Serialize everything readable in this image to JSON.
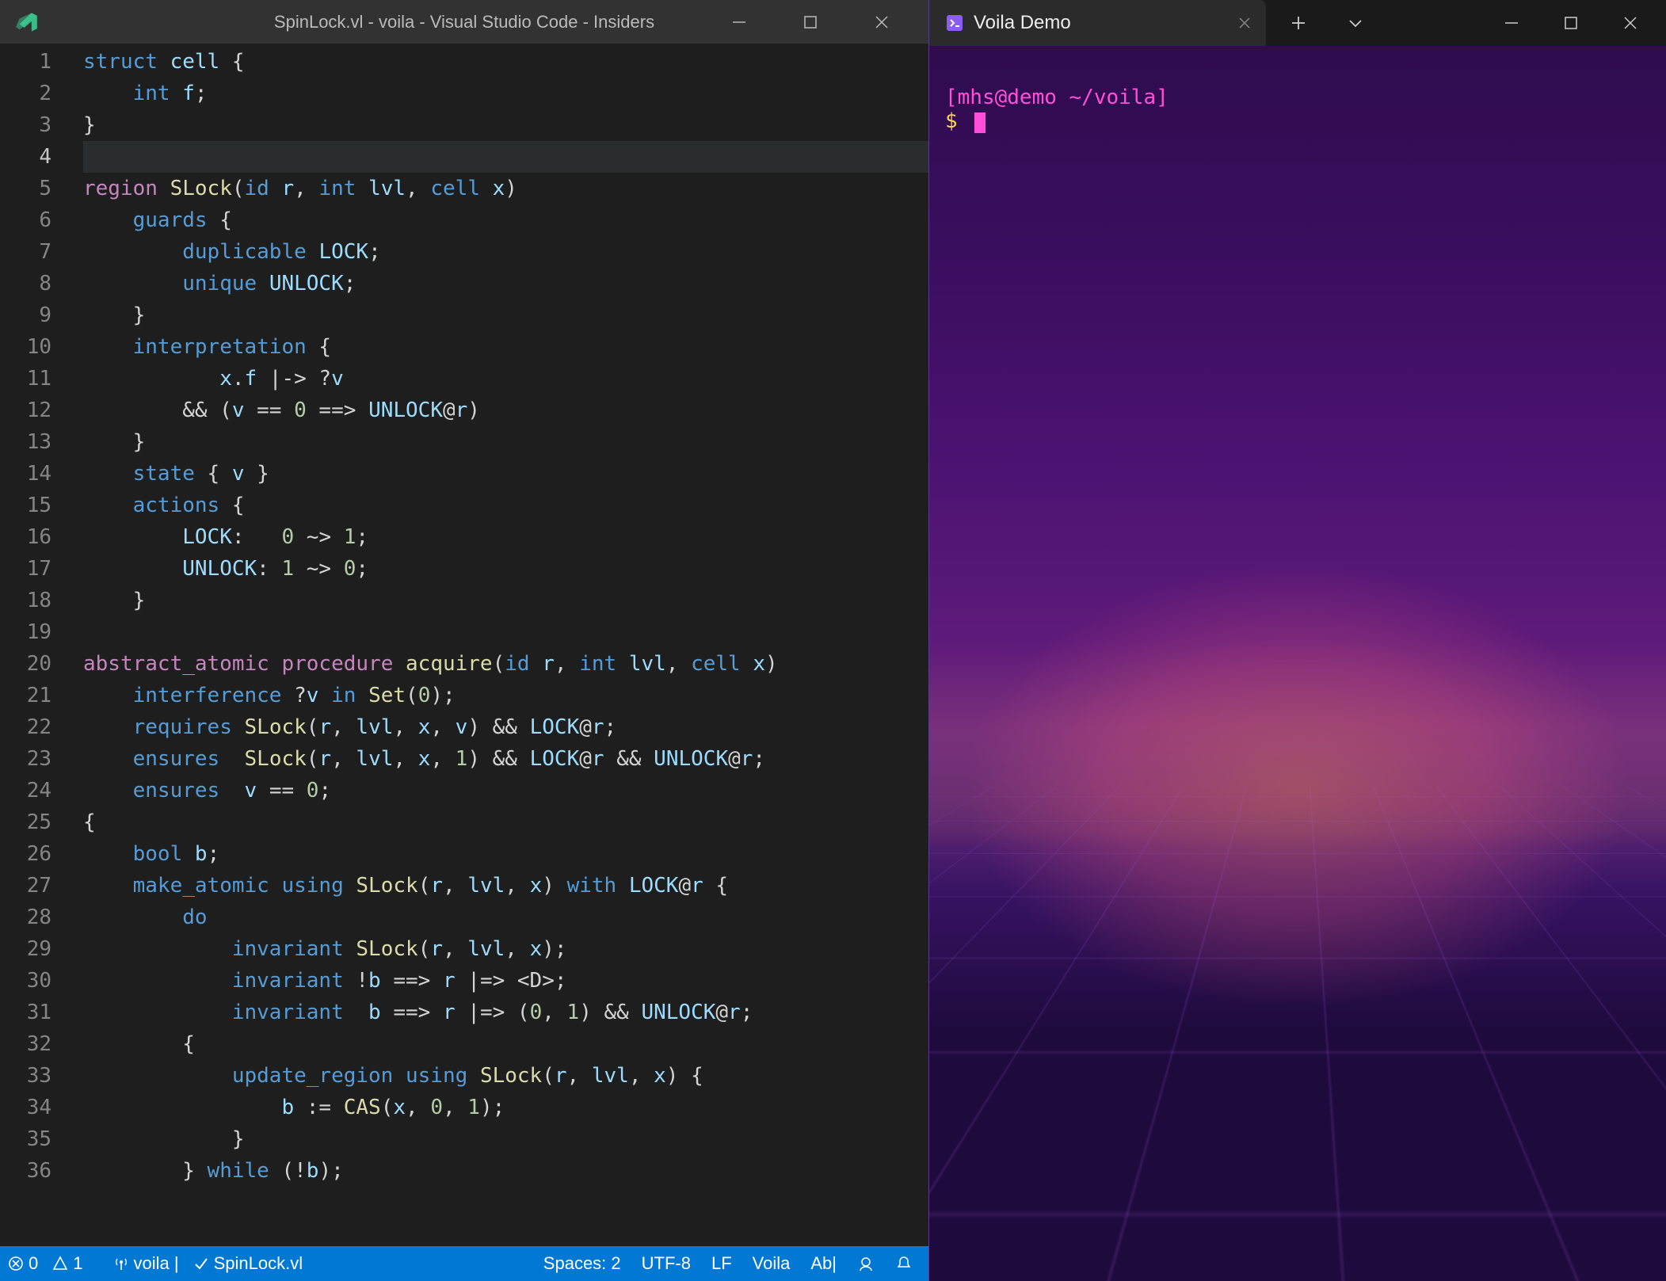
{
  "vscode": {
    "title": "SpinLock.vl - voila - Visual Studio Code - Insiders",
    "gutter_start": 1,
    "gutter_end": 36,
    "active_line": 4
  },
  "code_lines": [
    [
      [
        "k1",
        "struct"
      ],
      [
        "op",
        " "
      ],
      [
        "id",
        "cell"
      ],
      [
        "op",
        " {"
      ]
    ],
    [
      [
        "op",
        "    "
      ],
      [
        "k1",
        "int"
      ],
      [
        "op",
        " "
      ],
      [
        "id",
        "f"
      ],
      [
        "op",
        ";"
      ]
    ],
    [
      [
        "op",
        "}"
      ]
    ],
    [
      [
        "op",
        ""
      ]
    ],
    [
      [
        "k2",
        "region"
      ],
      [
        "op",
        " "
      ],
      [
        "fn",
        "SLock"
      ],
      [
        "op",
        "("
      ],
      [
        "k1",
        "id"
      ],
      [
        "op",
        " "
      ],
      [
        "id",
        "r"
      ],
      [
        "op",
        ", "
      ],
      [
        "k1",
        "int"
      ],
      [
        "op",
        " "
      ],
      [
        "id",
        "lvl"
      ],
      [
        "op",
        ", "
      ],
      [
        "k1",
        "cell"
      ],
      [
        "op",
        " "
      ],
      [
        "id",
        "x"
      ],
      [
        "op",
        ")"
      ]
    ],
    [
      [
        "op",
        "    "
      ],
      [
        "k3",
        "guards"
      ],
      [
        "op",
        " {"
      ]
    ],
    [
      [
        "op",
        "        "
      ],
      [
        "k3",
        "duplicable"
      ],
      [
        "op",
        " "
      ],
      [
        "id",
        "LOCK"
      ],
      [
        "op",
        ";"
      ]
    ],
    [
      [
        "op",
        "        "
      ],
      [
        "k3",
        "unique"
      ],
      [
        "op",
        " "
      ],
      [
        "id",
        "UNLOCK"
      ],
      [
        "op",
        ";"
      ]
    ],
    [
      [
        "op",
        "    }"
      ]
    ],
    [
      [
        "op",
        "    "
      ],
      [
        "k3",
        "interpretation"
      ],
      [
        "op",
        " {"
      ]
    ],
    [
      [
        "op",
        "           "
      ],
      [
        "id",
        "x"
      ],
      [
        "op",
        "."
      ],
      [
        "id",
        "f"
      ],
      [
        "op",
        " |-> ?"
      ],
      [
        "id",
        "v"
      ]
    ],
    [
      [
        "op",
        "        && ("
      ],
      [
        "id",
        "v"
      ],
      [
        "op",
        " == "
      ],
      [
        "num",
        "0"
      ],
      [
        "op",
        " ==> "
      ],
      [
        "id",
        "UNLOCK"
      ],
      [
        "op",
        "@"
      ],
      [
        "id",
        "r"
      ],
      [
        "op",
        ")"
      ]
    ],
    [
      [
        "op",
        "    }"
      ]
    ],
    [
      [
        "op",
        "    "
      ],
      [
        "k3",
        "state"
      ],
      [
        "op",
        " { "
      ],
      [
        "id",
        "v"
      ],
      [
        "op",
        " }"
      ]
    ],
    [
      [
        "op",
        "    "
      ],
      [
        "k3",
        "actions"
      ],
      [
        "op",
        " {"
      ]
    ],
    [
      [
        "op",
        "        "
      ],
      [
        "id",
        "LOCK"
      ],
      [
        "op",
        ":   "
      ],
      [
        "num",
        "0"
      ],
      [
        "op",
        " ~> "
      ],
      [
        "num",
        "1"
      ],
      [
        "op",
        ";"
      ]
    ],
    [
      [
        "op",
        "        "
      ],
      [
        "id",
        "UNLOCK"
      ],
      [
        "op",
        ": "
      ],
      [
        "num",
        "1"
      ],
      [
        "op",
        " ~> "
      ],
      [
        "num",
        "0"
      ],
      [
        "op",
        ";"
      ]
    ],
    [
      [
        "op",
        "    }"
      ]
    ],
    [
      [
        "op",
        ""
      ]
    ],
    [
      [
        "k2",
        "abstract_atomic"
      ],
      [
        "op",
        " "
      ],
      [
        "k2",
        "procedure"
      ],
      [
        "op",
        " "
      ],
      [
        "fn",
        "acquire"
      ],
      [
        "op",
        "("
      ],
      [
        "k1",
        "id"
      ],
      [
        "op",
        " "
      ],
      [
        "id",
        "r"
      ],
      [
        "op",
        ", "
      ],
      [
        "k1",
        "int"
      ],
      [
        "op",
        " "
      ],
      [
        "id",
        "lvl"
      ],
      [
        "op",
        ", "
      ],
      [
        "k1",
        "cell"
      ],
      [
        "op",
        " "
      ],
      [
        "id",
        "x"
      ],
      [
        "op",
        ")"
      ]
    ],
    [
      [
        "op",
        "    "
      ],
      [
        "k3",
        "interference"
      ],
      [
        "op",
        " ?"
      ],
      [
        "id",
        "v"
      ],
      [
        "op",
        " "
      ],
      [
        "k3",
        "in"
      ],
      [
        "op",
        " "
      ],
      [
        "fn",
        "Set"
      ],
      [
        "op",
        "("
      ],
      [
        "num",
        "0"
      ],
      [
        "op",
        ");"
      ]
    ],
    [
      [
        "op",
        "    "
      ],
      [
        "k3",
        "requires"
      ],
      [
        "op",
        " "
      ],
      [
        "fn",
        "SLock"
      ],
      [
        "op",
        "("
      ],
      [
        "id",
        "r"
      ],
      [
        "op",
        ", "
      ],
      [
        "id",
        "lvl"
      ],
      [
        "op",
        ", "
      ],
      [
        "id",
        "x"
      ],
      [
        "op",
        ", "
      ],
      [
        "id",
        "v"
      ],
      [
        "op",
        ") && "
      ],
      [
        "id",
        "LOCK"
      ],
      [
        "op",
        "@"
      ],
      [
        "id",
        "r"
      ],
      [
        "op",
        ";"
      ]
    ],
    [
      [
        "op",
        "    "
      ],
      [
        "k3",
        "ensures"
      ],
      [
        "op",
        "  "
      ],
      [
        "fn",
        "SLock"
      ],
      [
        "op",
        "("
      ],
      [
        "id",
        "r"
      ],
      [
        "op",
        ", "
      ],
      [
        "id",
        "lvl"
      ],
      [
        "op",
        ", "
      ],
      [
        "id",
        "x"
      ],
      [
        "op",
        ", "
      ],
      [
        "num",
        "1"
      ],
      [
        "op",
        ") && "
      ],
      [
        "id",
        "LOCK"
      ],
      [
        "op",
        "@"
      ],
      [
        "id",
        "r"
      ],
      [
        "op",
        " && "
      ],
      [
        "id",
        "UNLOCK"
      ],
      [
        "op",
        "@"
      ],
      [
        "id",
        "r"
      ],
      [
        "op",
        ";"
      ]
    ],
    [
      [
        "op",
        "    "
      ],
      [
        "k3",
        "ensures"
      ],
      [
        "op",
        "  "
      ],
      [
        "id",
        "v"
      ],
      [
        "op",
        " == "
      ],
      [
        "num",
        "0"
      ],
      [
        "op",
        ";"
      ]
    ],
    [
      [
        "op",
        "{"
      ]
    ],
    [
      [
        "op",
        "    "
      ],
      [
        "k1",
        "bool"
      ],
      [
        "op",
        " "
      ],
      [
        "id",
        "b"
      ],
      [
        "op",
        ";"
      ]
    ],
    [
      [
        "op",
        "    "
      ],
      [
        "k3",
        "make_atomic"
      ],
      [
        "op",
        " "
      ],
      [
        "k3",
        "using"
      ],
      [
        "op",
        " "
      ],
      [
        "fn",
        "SLock"
      ],
      [
        "op",
        "("
      ],
      [
        "id",
        "r"
      ],
      [
        "op",
        ", "
      ],
      [
        "id",
        "lvl"
      ],
      [
        "op",
        ", "
      ],
      [
        "id",
        "x"
      ],
      [
        "op",
        ") "
      ],
      [
        "k3",
        "with"
      ],
      [
        "op",
        " "
      ],
      [
        "id",
        "LOCK"
      ],
      [
        "op",
        "@"
      ],
      [
        "id",
        "r"
      ],
      [
        "op",
        " {"
      ]
    ],
    [
      [
        "op",
        "        "
      ],
      [
        "k3",
        "do"
      ]
    ],
    [
      [
        "op",
        "            "
      ],
      [
        "k3",
        "invariant"
      ],
      [
        "op",
        " "
      ],
      [
        "fn",
        "SLock"
      ],
      [
        "op",
        "("
      ],
      [
        "id",
        "r"
      ],
      [
        "op",
        ", "
      ],
      [
        "id",
        "lvl"
      ],
      [
        "op",
        ", "
      ],
      [
        "id",
        "x"
      ],
      [
        "op",
        ");"
      ]
    ],
    [
      [
        "op",
        "            "
      ],
      [
        "k3",
        "invariant"
      ],
      [
        "op",
        " !"
      ],
      [
        "id",
        "b"
      ],
      [
        "op",
        " ==> "
      ],
      [
        "id",
        "r"
      ],
      [
        "op",
        " |=> <D>;"
      ]
    ],
    [
      [
        "op",
        "            "
      ],
      [
        "k3",
        "invariant"
      ],
      [
        "op",
        "  "
      ],
      [
        "id",
        "b"
      ],
      [
        "op",
        " ==> "
      ],
      [
        "id",
        "r"
      ],
      [
        "op",
        " |=> ("
      ],
      [
        "num",
        "0"
      ],
      [
        "op",
        ", "
      ],
      [
        "num",
        "1"
      ],
      [
        "op",
        ") && "
      ],
      [
        "id",
        "UNLOCK"
      ],
      [
        "op",
        "@"
      ],
      [
        "id",
        "r"
      ],
      [
        "op",
        ";"
      ]
    ],
    [
      [
        "op",
        "        {"
      ]
    ],
    [
      [
        "op",
        "            "
      ],
      [
        "k3",
        "update_region"
      ],
      [
        "op",
        " "
      ],
      [
        "k3",
        "using"
      ],
      [
        "op",
        " "
      ],
      [
        "fn",
        "SLock"
      ],
      [
        "op",
        "("
      ],
      [
        "id",
        "r"
      ],
      [
        "op",
        ", "
      ],
      [
        "id",
        "lvl"
      ],
      [
        "op",
        ", "
      ],
      [
        "id",
        "x"
      ],
      [
        "op",
        ") {"
      ]
    ],
    [
      [
        "op",
        "                "
      ],
      [
        "id",
        "b"
      ],
      [
        "op",
        " := "
      ],
      [
        "fn",
        "CAS"
      ],
      [
        "op",
        "("
      ],
      [
        "id",
        "x"
      ],
      [
        "op",
        ", "
      ],
      [
        "num",
        "0"
      ],
      [
        "op",
        ", "
      ],
      [
        "num",
        "1"
      ],
      [
        "op",
        ");"
      ]
    ],
    [
      [
        "op",
        "            }"
      ]
    ],
    [
      [
        "op",
        "        } "
      ],
      [
        "k3",
        "while"
      ],
      [
        "op",
        " (!"
      ],
      [
        "id",
        "b"
      ],
      [
        "op",
        ");"
      ]
    ]
  ],
  "statusbar": {
    "errors": "0",
    "warnings": "1",
    "folder": "voila |",
    "scm": "SpinLock.vl",
    "spaces": "Spaces: 2",
    "encoding": "UTF-8",
    "eol": "LF",
    "lang": "Voila",
    "spell": "Ab|"
  },
  "terminal": {
    "tab_title": "Voila Demo",
    "prompt_user": "[mhs@demo ~/voila]",
    "prompt_symbol": "$"
  }
}
